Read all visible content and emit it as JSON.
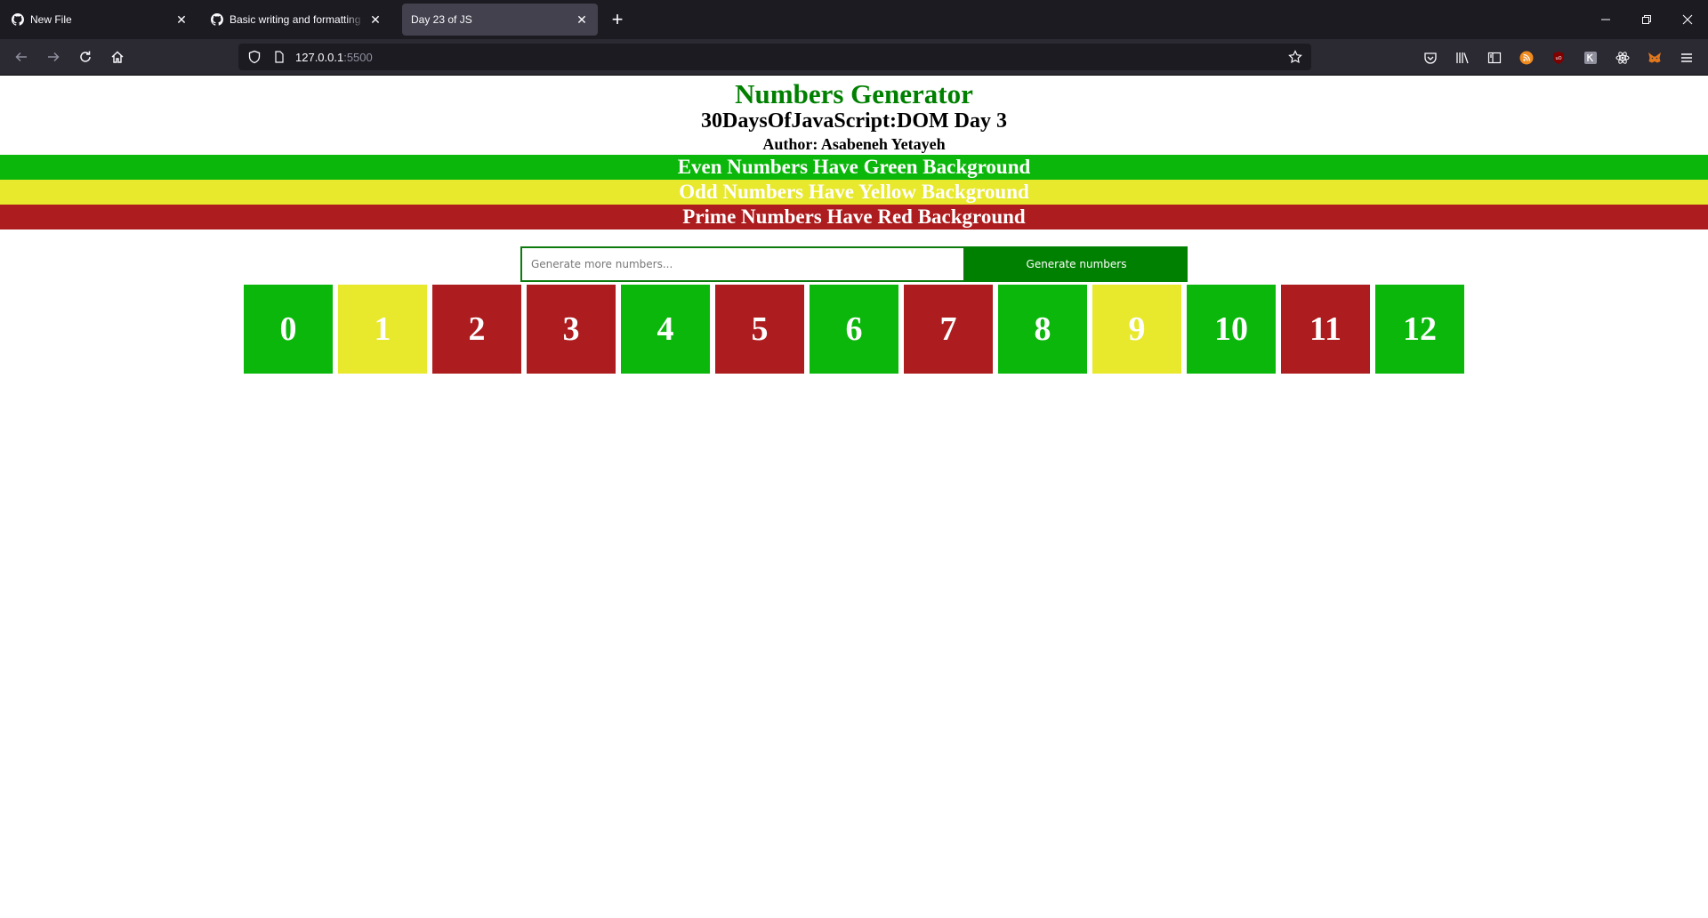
{
  "browser": {
    "tabs": [
      {
        "title": "New File",
        "icon": "github-icon",
        "active": false
      },
      {
        "title": "Basic writing and formatting syntax",
        "icon": "github-icon",
        "active": false
      },
      {
        "title": "Day 23 of JS",
        "icon": "",
        "active": true
      }
    ],
    "new_tab_label": "+",
    "url_host": "127.0.0.1",
    "url_port": ":5500"
  },
  "page": {
    "title": "Numbers Generator",
    "subtitle": "30DaysOfJavaScript:DOM Day 3",
    "author": "Author: Asabeneh Yetayeh",
    "legend": {
      "even": "Even Numbers Have Green Background",
      "odd": "Odd Numbers Have Yellow Background",
      "prime": "Prime Numbers Have Red Background"
    },
    "input_placeholder": "Generate more numbers...",
    "input_value": "",
    "button_label": "Generate numbers",
    "colors": {
      "even": "#0bb70b",
      "odd": "#e8e82c",
      "prime": "#ad1c1e",
      "title": "#008000"
    },
    "numbers": [
      {
        "value": "0",
        "kind": "even"
      },
      {
        "value": "1",
        "kind": "odd"
      },
      {
        "value": "2",
        "kind": "prime"
      },
      {
        "value": "3",
        "kind": "prime"
      },
      {
        "value": "4",
        "kind": "even"
      },
      {
        "value": "5",
        "kind": "prime"
      },
      {
        "value": "6",
        "kind": "even"
      },
      {
        "value": "7",
        "kind": "prime"
      },
      {
        "value": "8",
        "kind": "even"
      },
      {
        "value": "9",
        "kind": "odd"
      },
      {
        "value": "10",
        "kind": "even"
      },
      {
        "value": "11",
        "kind": "prime"
      },
      {
        "value": "12",
        "kind": "even"
      }
    ]
  }
}
